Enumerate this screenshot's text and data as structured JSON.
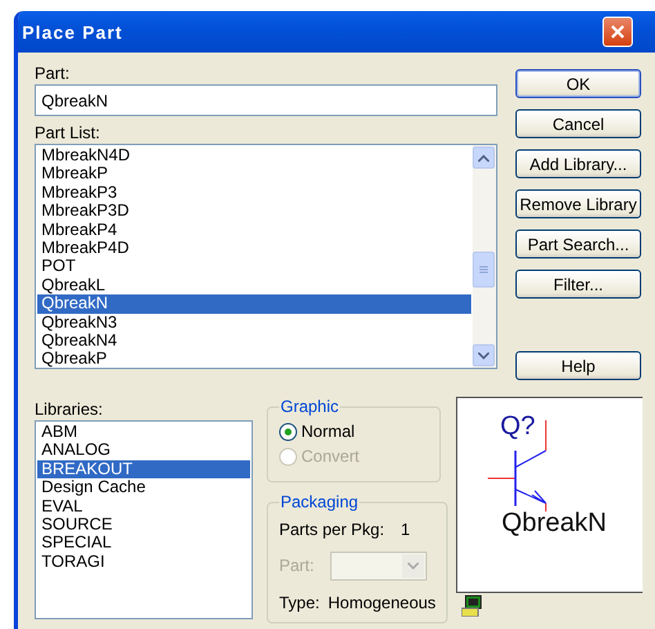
{
  "window": {
    "title": "Place Part"
  },
  "part": {
    "label": "Part:",
    "value": "QbreakN"
  },
  "part_list": {
    "label": "Part List:",
    "items": [
      {
        "label": "MbreakN4D",
        "selected": false
      },
      {
        "label": "MbreakP",
        "selected": false
      },
      {
        "label": "MbreakP3",
        "selected": false
      },
      {
        "label": "MbreakP3D",
        "selected": false
      },
      {
        "label": "MbreakP4",
        "selected": false
      },
      {
        "label": "MbreakP4D",
        "selected": false
      },
      {
        "label": "POT",
        "selected": false
      },
      {
        "label": "QbreakL",
        "selected": false
      },
      {
        "label": "QbreakN",
        "selected": true
      },
      {
        "label": "QbreakN3",
        "selected": false
      },
      {
        "label": "QbreakN4",
        "selected": false
      },
      {
        "label": "QbreakP",
        "selected": false
      }
    ]
  },
  "buttons": [
    {
      "label": "OK",
      "default": true
    },
    {
      "label": "Cancel",
      "default": false
    },
    {
      "label": "Add Library...",
      "default": false
    },
    {
      "label": "Remove Library",
      "default": false
    },
    {
      "label": "Part Search...",
      "default": false
    },
    {
      "label": "Filter...",
      "default": false
    }
  ],
  "help_button": {
    "label": "Help"
  },
  "libraries": {
    "label": "Libraries:",
    "items": [
      {
        "label": "ABM",
        "selected": false
      },
      {
        "label": "ANALOG",
        "selected": false
      },
      {
        "label": "BREAKOUT",
        "selected": true
      },
      {
        "label": "Design Cache",
        "selected": false
      },
      {
        "label": "EVAL",
        "selected": false
      },
      {
        "label": "SOURCE",
        "selected": false
      },
      {
        "label": "SPECIAL",
        "selected": false
      },
      {
        "label": "TORAGI",
        "selected": false
      }
    ]
  },
  "graphic": {
    "title": "Graphic",
    "options": [
      {
        "label": "Normal",
        "selected": true,
        "disabled": false
      },
      {
        "label": "Convert",
        "selected": false,
        "disabled": true
      }
    ]
  },
  "packaging": {
    "title": "Packaging",
    "parts_per_pkg_label": "Parts per Pkg:",
    "parts_per_pkg": "1",
    "part_label": "Part:",
    "part_disabled": true,
    "type_label": "Type:",
    "type": "Homogeneous"
  },
  "preview": {
    "ref": "Q?",
    "name": "QbreakN"
  }
}
